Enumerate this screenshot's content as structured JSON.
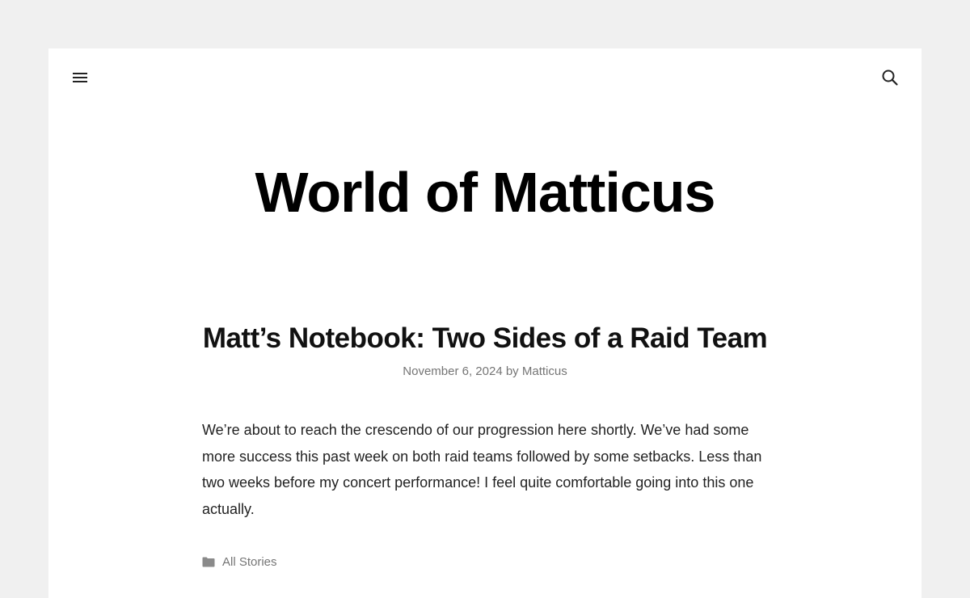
{
  "header": {
    "menu_icon": "hamburger-menu-icon",
    "search_icon": "search-icon",
    "site_title": "World of Matticus"
  },
  "post": {
    "title": "Matt’s Notebook: Two Sides of a Raid Team",
    "date": "November 6, 2024",
    "by": "by",
    "author": "Matticus",
    "excerpt": "We’re about to reach the crescendo of our progression here shortly. We’ve had some more success this past week on both raid teams followed by some setbacks. Less than two weeks before my concert performance! I feel quite comfortable going into this one actually.",
    "category_icon": "folder-icon",
    "category": "All Stories"
  },
  "colors": {
    "background": "#f0f0f0",
    "card": "#ffffff",
    "title": "#000000",
    "meta": "#757575",
    "body_text": "#222222"
  }
}
